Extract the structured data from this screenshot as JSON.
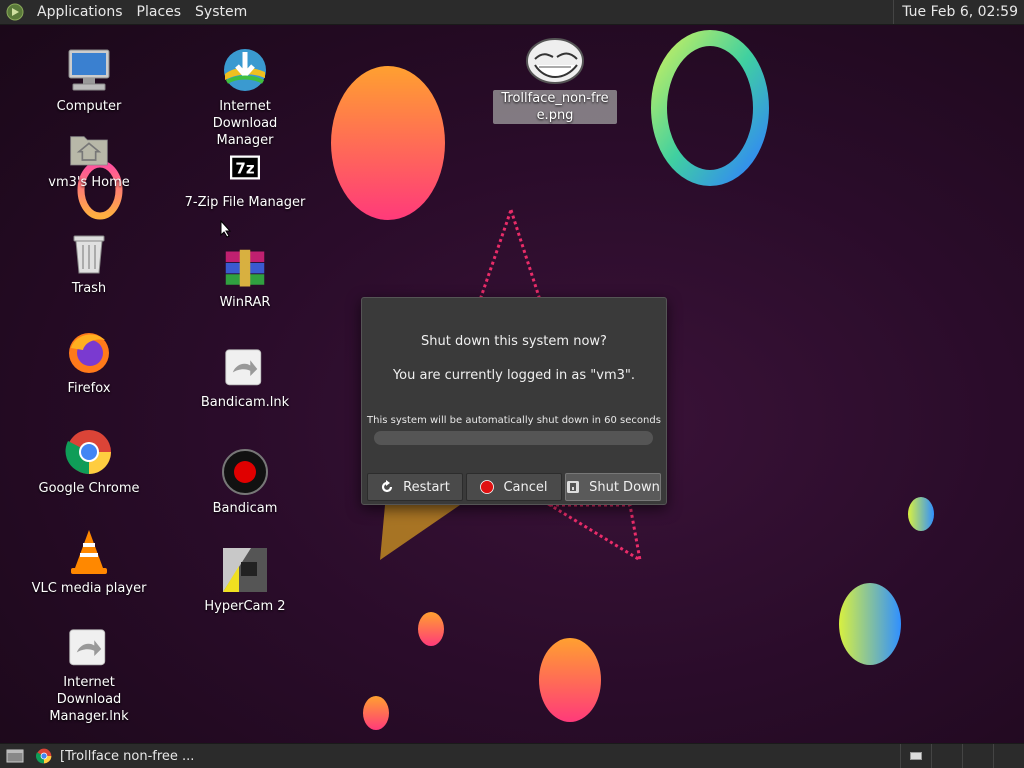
{
  "top_panel": {
    "menus": [
      "Applications",
      "Places",
      "System"
    ],
    "clock": "Tue Feb  6, 02:59"
  },
  "desktop_icons": [
    {
      "label": "Computer",
      "icon": "computer-icon"
    },
    {
      "label": "vm3's Home",
      "icon": "home-folder-icon"
    },
    {
      "label": "Trash",
      "icon": "trash-icon"
    },
    {
      "label": "Firefox",
      "icon": "firefox-icon"
    },
    {
      "label": "Google Chrome",
      "icon": "chrome-icon"
    },
    {
      "label": "VLC media player",
      "icon": "vlc-icon"
    },
    {
      "label": "Internet Download Manager.lnk",
      "icon": "shortcut-icon"
    },
    {
      "label": "Internet Download Manager",
      "icon": "idm-icon"
    },
    {
      "label": "7-Zip File Manager",
      "icon": "7zip-icon"
    },
    {
      "label": "WinRAR",
      "icon": "winrar-icon"
    },
    {
      "label": "Bandicam.lnk",
      "icon": "shortcut-icon"
    },
    {
      "label": "Bandicam",
      "icon": "bandicam-icon"
    },
    {
      "label": "HyperCam 2",
      "icon": "hypercam-icon"
    },
    {
      "label": "Trollface_non-free.png",
      "icon": "image-file-icon"
    }
  ],
  "dialog": {
    "title": "Shut down this system now?",
    "subtitle": "You are currently logged in as \"vm3\".",
    "note": "This system will be automatically shut down in 60 seconds",
    "progress": 0,
    "buttons": {
      "restart": "Restart",
      "cancel": "Cancel",
      "shutdown": "Shut Down"
    }
  },
  "taskbar": {
    "task_label": "[Trollface non-free ..."
  },
  "colors": {
    "panel": "#2b2b2b",
    "dialog": "#3a3a3a",
    "desktop": "#2a0c2a"
  }
}
